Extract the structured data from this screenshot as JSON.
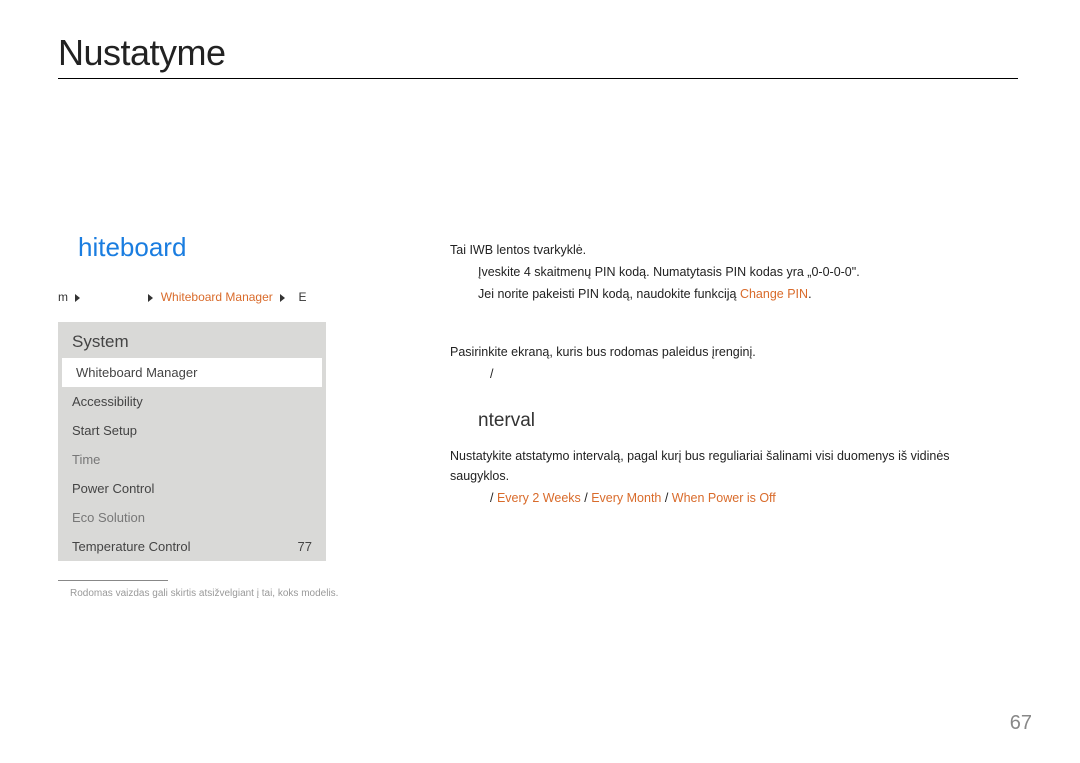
{
  "chapter": "Nustatyme",
  "blueHeading": "hiteboard",
  "breadcrumb": {
    "iconM": "m",
    "item": "Whiteboard Manager",
    "iconE": "E"
  },
  "menu": {
    "title": "System",
    "items": [
      {
        "label": "Whiteboard Manager",
        "value": "",
        "selected": true,
        "alt": false
      },
      {
        "label": "Accessibility",
        "value": "",
        "selected": false,
        "alt": false
      },
      {
        "label": "Start Setup",
        "value": "",
        "selected": false,
        "alt": false
      },
      {
        "label": "Time",
        "value": "",
        "selected": false,
        "alt": true
      },
      {
        "label": "Power Control",
        "value": "",
        "selected": false,
        "alt": false
      },
      {
        "label": "Eco Solution",
        "value": "",
        "selected": false,
        "alt": true
      },
      {
        "label": "Temperature Control",
        "value": "77",
        "selected": false,
        "alt": false
      }
    ]
  },
  "footnote": "Rodomas vaizdas gali skirtis atsižvelgiant į tai, koks modelis.",
  "right": {
    "line1": "Tai IWB lentos tvarkyklė.",
    "line2a": "Įveskite 4 skaitmenų PIN kodą. Numatytasis PIN kodas yra „0-0-0-0\".",
    "line2b_pre": "Jei norite pakeisti PIN kodą, naudokite funkciją ",
    "line2b_orange": "Change PIN",
    "line2b_post": ".",
    "heading1": "",
    "para1": "Pasirinkite ekraną, kuris bus rodomas paleidus įrenginį.",
    "bullet1": "/",
    "heading2": "nterval",
    "para2": "Nustatykite atstatymo intervalą, pagal kurį bus reguliariai šalinami visi duomenys iš vidinės saugyklos.",
    "bullet2_pre": "/ ",
    "bullet2_o1": "Every 2 Weeks",
    "bullet2_sep1": " / ",
    "bullet2_o2": "Every Month",
    "bullet2_sep2": " / ",
    "bullet2_o3": "When Power is Off"
  },
  "pageNumber": "67"
}
